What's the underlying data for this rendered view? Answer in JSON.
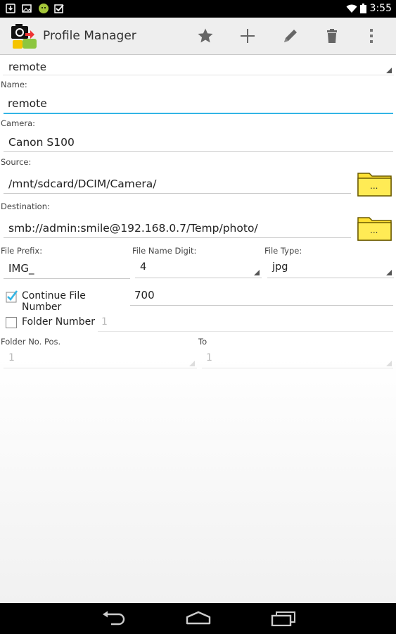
{
  "status_bar": {
    "time": "3:55",
    "icons": [
      "download-icon",
      "image-icon",
      "android-icon",
      "checkbox-icon",
      "wifi-icon",
      "battery-icon"
    ]
  },
  "action_bar": {
    "title": "Profile Manager",
    "actions": [
      "star-icon",
      "add-icon",
      "edit-icon",
      "delete-icon",
      "overflow-icon"
    ]
  },
  "profile_selector": {
    "value": "remote"
  },
  "name": {
    "label": "Name:",
    "value": "remote"
  },
  "camera": {
    "label": "Camera:",
    "value": "Canon S100"
  },
  "source": {
    "label": "Source:",
    "value": "/mnt/sdcard/DCIM/Camera/",
    "folder_label": "..."
  },
  "destination": {
    "label": "Destination:",
    "value": "smb://admin:smile@192.168.0.7/Temp/photo/",
    "folder_label": "..."
  },
  "file_prefix": {
    "label": "File Prefix:",
    "value": "IMG_"
  },
  "file_name_digit": {
    "label": "File Name Digit:",
    "value": "4"
  },
  "file_type": {
    "label": "File Type:",
    "value": "jpg"
  },
  "continue_file_number": {
    "label": "Continue File Number",
    "checked": true,
    "value": "700"
  },
  "folder_number": {
    "label": "Folder Number",
    "checked": false,
    "value": "1"
  },
  "folder_no_pos": {
    "label": "Folder No. Pos.",
    "value": "1"
  },
  "to": {
    "label": "To",
    "value": "1"
  },
  "colors": {
    "accent": "#33b5e5",
    "status_bar": "#000000",
    "action_bar": "#eeeeee",
    "folder": "#ffe033"
  }
}
